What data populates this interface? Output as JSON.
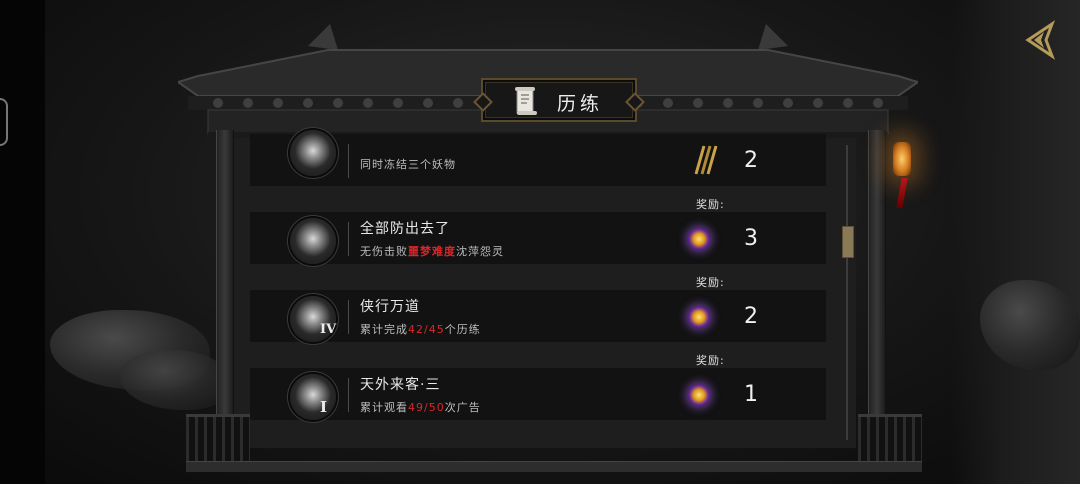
{
  "title": "历练",
  "reward_label": "奖励:",
  "rows": [
    {
      "name": "",
      "desc": "同时冻结三个妖物",
      "reward_count": "2",
      "reward_icon": "arrow-bundle-icon"
    },
    {
      "name": "全部防出去了",
      "desc_parts": [
        "无伤击败",
        "噩梦难度",
        "沈萍怨灵"
      ],
      "reward_count": "3",
      "reward_icon": "purple-orb-icon"
    },
    {
      "name": "侠行万道",
      "desc_parts": [
        "累计完成",
        "42/45",
        "个历练"
      ],
      "badge": "IV",
      "reward_count": "2",
      "reward_icon": "purple-orb-icon"
    },
    {
      "name": "天外来客·三",
      "desc_parts": [
        "累计观看",
        "49/50",
        "次广告"
      ],
      "badge": "I",
      "reward_count": "1",
      "reward_icon": "purple-orb-icon"
    }
  ],
  "colors": {
    "highlight": "#d9262a",
    "panel": "#1e1e1e",
    "row": "#121212",
    "frame_gold": "#5a4a2c"
  },
  "icons": [
    "back-arrow-icon",
    "scroll-icon",
    "lantern-icon"
  ]
}
